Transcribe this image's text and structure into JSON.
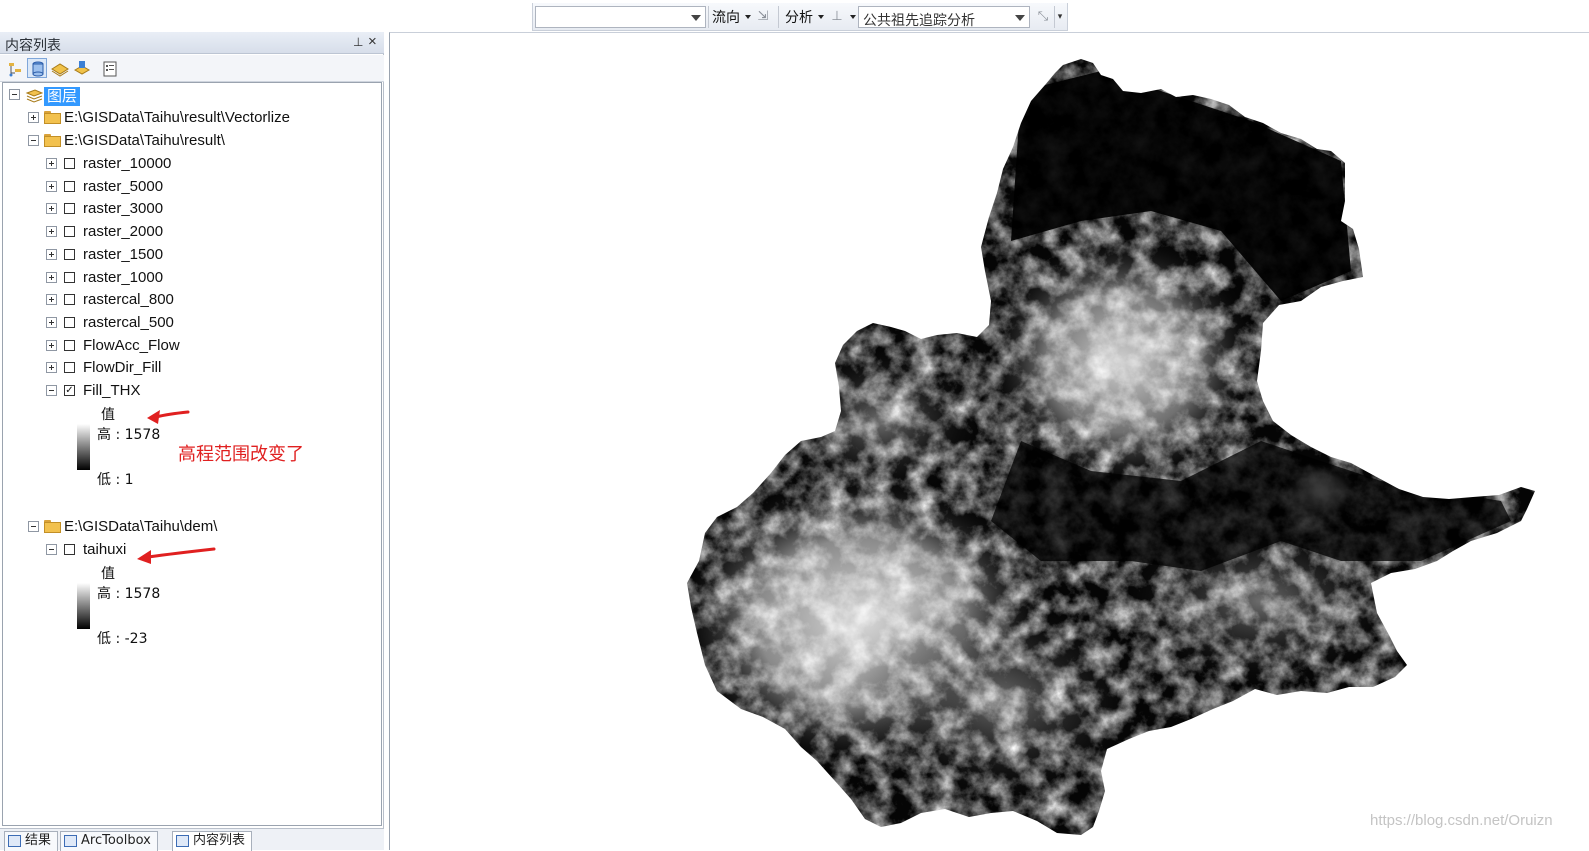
{
  "toolbar": {
    "dropdown1_value": "",
    "flow_label": "流向",
    "analysis_label": "分析",
    "trace_task_value": "公共祖先追踪分析"
  },
  "toc": {
    "title": "内容列表",
    "pin_glyph": "ᴾ",
    "close_glyph": "×",
    "root_label": "图层",
    "groups": [
      {
        "path": "E:\\GISData\\Taihu\\result\\Vectorlize",
        "expanded": false
      },
      {
        "path": "E:\\GISData\\Taihu\\result\\",
        "expanded": true
      },
      {
        "path": "E:\\GISData\\Taihu\\dem\\",
        "expanded": true
      }
    ],
    "layers": [
      {
        "name": "raster_10000",
        "checked": false
      },
      {
        "name": "raster_5000",
        "checked": false
      },
      {
        "name": "raster_3000",
        "checked": false
      },
      {
        "name": "raster_2000",
        "checked": false
      },
      {
        "name": "raster_1500",
        "checked": false
      },
      {
        "name": "raster_1000",
        "checked": false
      },
      {
        "name": "rastercal_800",
        "checked": false
      },
      {
        "name": "rastercal_500",
        "checked": false
      },
      {
        "name": "FlowAcc_Flow",
        "checked": false
      },
      {
        "name": "FlowDir_Fill",
        "checked": false
      },
      {
        "name": "Fill_THX",
        "checked": true
      }
    ],
    "fill_legend": {
      "title": "值",
      "high": "高 : 1578",
      "low": "低 : 1"
    },
    "dem_layer": {
      "name": "taihuxi",
      "checked": false
    },
    "dem_legend": {
      "title": "值",
      "high": "高 : 1578",
      "low": "低 : -23"
    },
    "bottom_tabs": [
      "结果",
      "ArcToolbox",
      "内容列表"
    ]
  },
  "annotation": {
    "text": "高程范围改变了",
    "color": "#e02020"
  },
  "watermark": "https://blog.csdn.net/Oruizn"
}
